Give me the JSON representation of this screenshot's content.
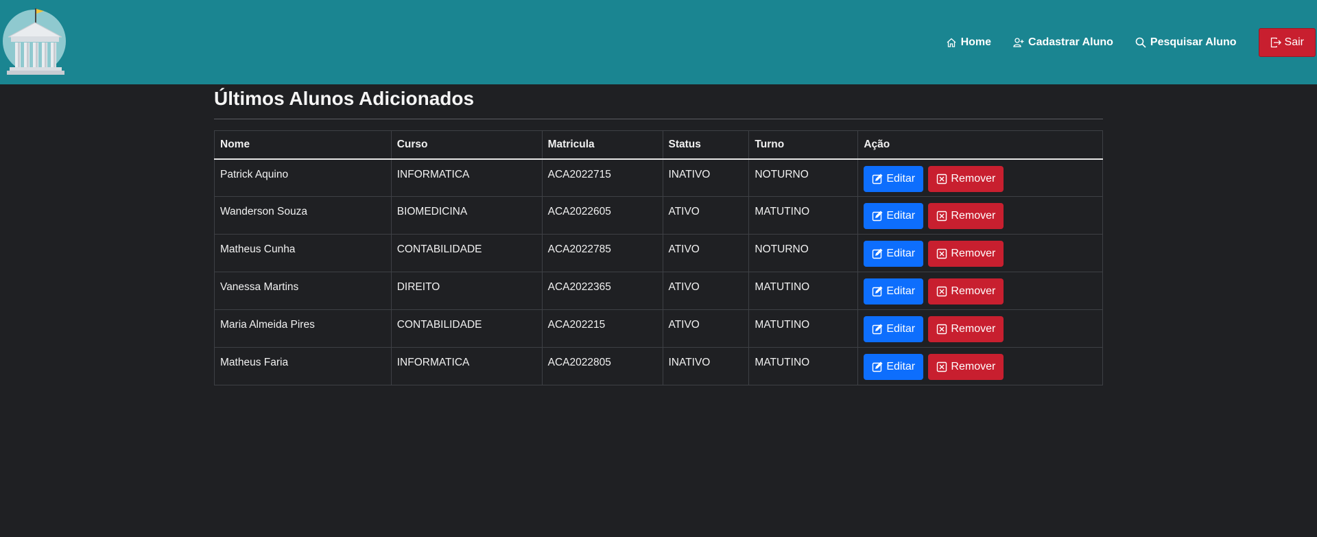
{
  "nav": {
    "links": [
      {
        "label": "Home",
        "icon": "home-icon"
      },
      {
        "label": "Cadastrar Aluno",
        "icon": "user-plus-icon"
      },
      {
        "label": "Pesquisar Aluno",
        "icon": "search-icon"
      }
    ],
    "logout_label": "Sair",
    "logout_icon": "logout-icon"
  },
  "page": {
    "title": "Últimos Alunos Adicionados"
  },
  "table": {
    "headers": [
      "Nome",
      "Curso",
      "Matricula",
      "Status",
      "Turno",
      "Ação"
    ],
    "rows": [
      {
        "nome": "Patrick Aquino",
        "curso": "INFORMATICA",
        "matricula": "ACA2022715",
        "status": "INATIVO",
        "turno": "NOTURNO"
      },
      {
        "nome": "Wanderson Souza",
        "curso": "BIOMEDICINA",
        "matricula": "ACA2022605",
        "status": "ATIVO",
        "turno": "MATUTINO"
      },
      {
        "nome": "Matheus Cunha",
        "curso": "CONTABILIDADE",
        "matricula": "ACA2022785",
        "status": "ATIVO",
        "turno": "NOTURNO"
      },
      {
        "nome": "Vanessa Martins",
        "curso": "DIREITO",
        "matricula": "ACA2022365",
        "status": "ATIVO",
        "turno": "MATUTINO"
      },
      {
        "nome": "Maria Almeida Pires",
        "curso": "CONTABILIDADE",
        "matricula": "ACA202215",
        "status": "ATIVO",
        "turno": "MATUTINO"
      },
      {
        "nome": "Matheus Faria",
        "curso": "INFORMATICA",
        "matricula": "ACA2022805",
        "status": "INATIVO",
        "turno": "MATUTINO"
      }
    ],
    "edit_label": "Editar",
    "remove_label": "Remover"
  },
  "colors": {
    "navbar": "#1a8591",
    "background": "#1f2023",
    "edit_button": "#0d6efd",
    "remove_button": "#c81f2f"
  }
}
